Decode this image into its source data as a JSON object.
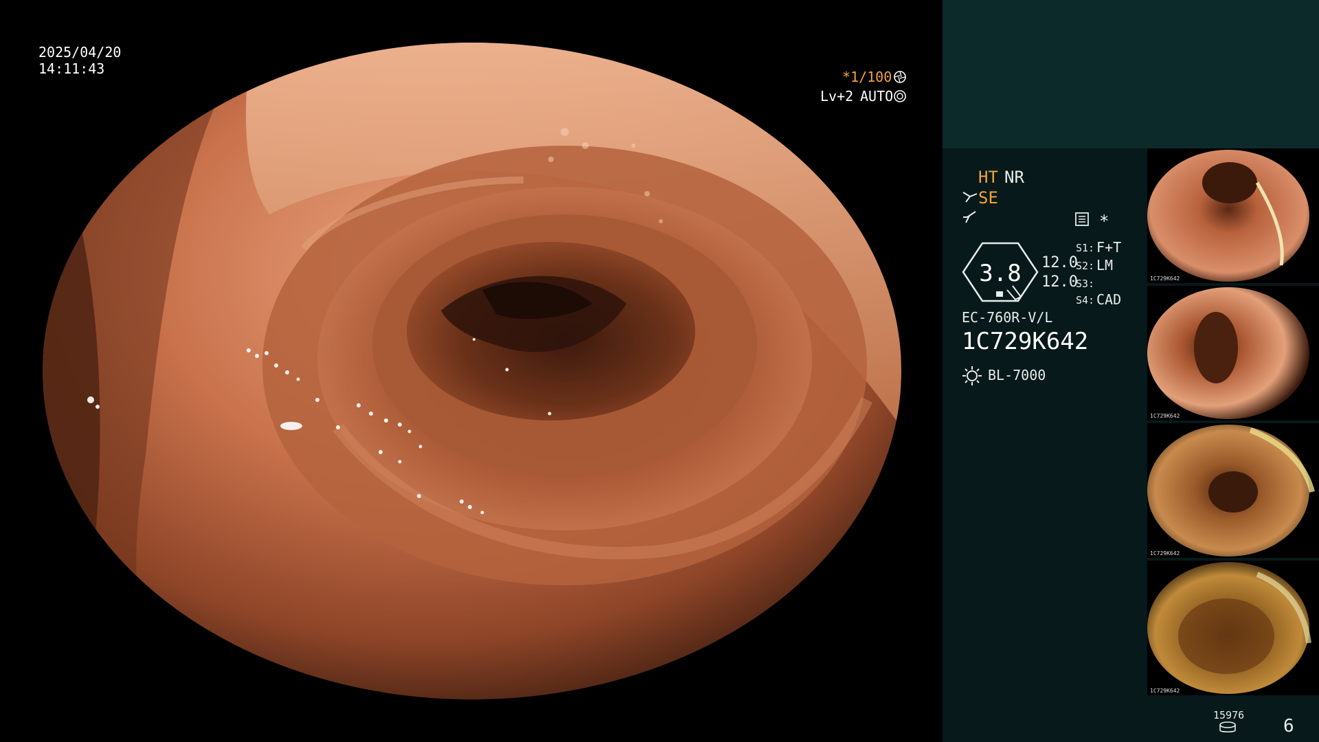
{
  "datetime": {
    "date": "2025/04/20",
    "time": "14:11:43"
  },
  "exposure": {
    "shutter": "*1/100",
    "level": "Lv+2",
    "mode": "AUTO"
  },
  "processing": {
    "ht": "HT",
    "nr": "NR",
    "se": "SE",
    "star": "*"
  },
  "settings": {
    "gauge_value": "3.8",
    "value_a": "12.0",
    "value_b": "12.0",
    "s1_key": "S1:",
    "s1_val": "F+T",
    "s2_key": "S2:",
    "s2_val": "LM",
    "s3_key": "S3:",
    "s3_val": "",
    "s4_key": "S4:",
    "s4_val": "CAD"
  },
  "device": {
    "model": "EC-760R-V/L",
    "serial": "1C729K642",
    "light_source": "BL-7000"
  },
  "storage": {
    "count": "15976",
    "page": "6"
  },
  "thumbnails": [
    {
      "id": "1C729K642"
    },
    {
      "id": "1C729K642"
    },
    {
      "id": "1C729K642"
    },
    {
      "id": "1C729K642"
    }
  ],
  "colors": {
    "accent_orange": "#f3a33c",
    "panel_bg": "#07191a",
    "panel_top_bg": "#0d2a2b",
    "text": "#ffffff"
  },
  "icons": [
    "aperture-icon",
    "auto-iris-icon",
    "scissors-icon",
    "lightning-icon",
    "document-icon",
    "sun-icon",
    "storage-icon"
  ]
}
